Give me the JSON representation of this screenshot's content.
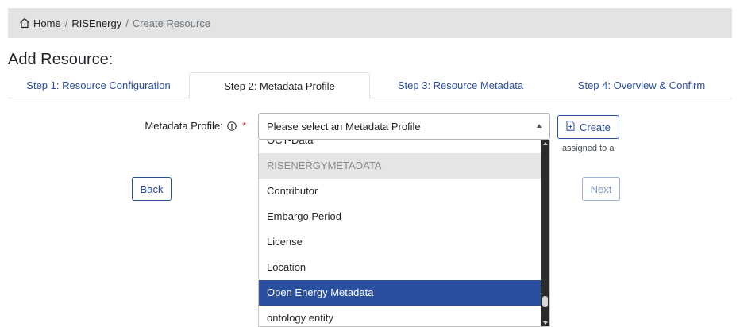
{
  "breadcrumb": {
    "home": "Home",
    "project": "RISEnergy",
    "current": "Create Resource",
    "separator": "/"
  },
  "page_title": "Add Resource:",
  "tabs": [
    {
      "label": "Step 1: Resource Configuration",
      "active": false
    },
    {
      "label": "Step 2: Metadata Profile",
      "active": true
    },
    {
      "label": "Step 3: Resource Metadata",
      "active": false
    },
    {
      "label": "Step 4: Overview & Confirm",
      "active": false
    }
  ],
  "form": {
    "label": "Metadata Profile:",
    "required_mark": "*",
    "select_placeholder": "Please select an Metadata Profile",
    "create_label": "Create",
    "hint_fragment": "assigned to a"
  },
  "nav": {
    "back_label": "Back",
    "next_label": "Next"
  },
  "dropdown": {
    "options": [
      {
        "label": "OCT-Data",
        "type": "option"
      },
      {
        "label": "RISENERGYMETADATA",
        "type": "group"
      },
      {
        "label": "Contributor",
        "type": "option"
      },
      {
        "label": "Embargo Period",
        "type": "option"
      },
      {
        "label": "License",
        "type": "option"
      },
      {
        "label": "Location",
        "type": "option"
      },
      {
        "label": "Open Energy Metadata",
        "type": "option",
        "selected": true
      },
      {
        "label": "ontology entity",
        "type": "option"
      }
    ]
  },
  "colors": {
    "accent": "#2b4f9f",
    "breadcrumb_bg": "#e3e3e3",
    "required": "#dc3545",
    "scrollbar": "#2b2b2b"
  },
  "icons": {
    "home": "home-icon",
    "info": "info-icon",
    "create": "file-plus-icon"
  }
}
